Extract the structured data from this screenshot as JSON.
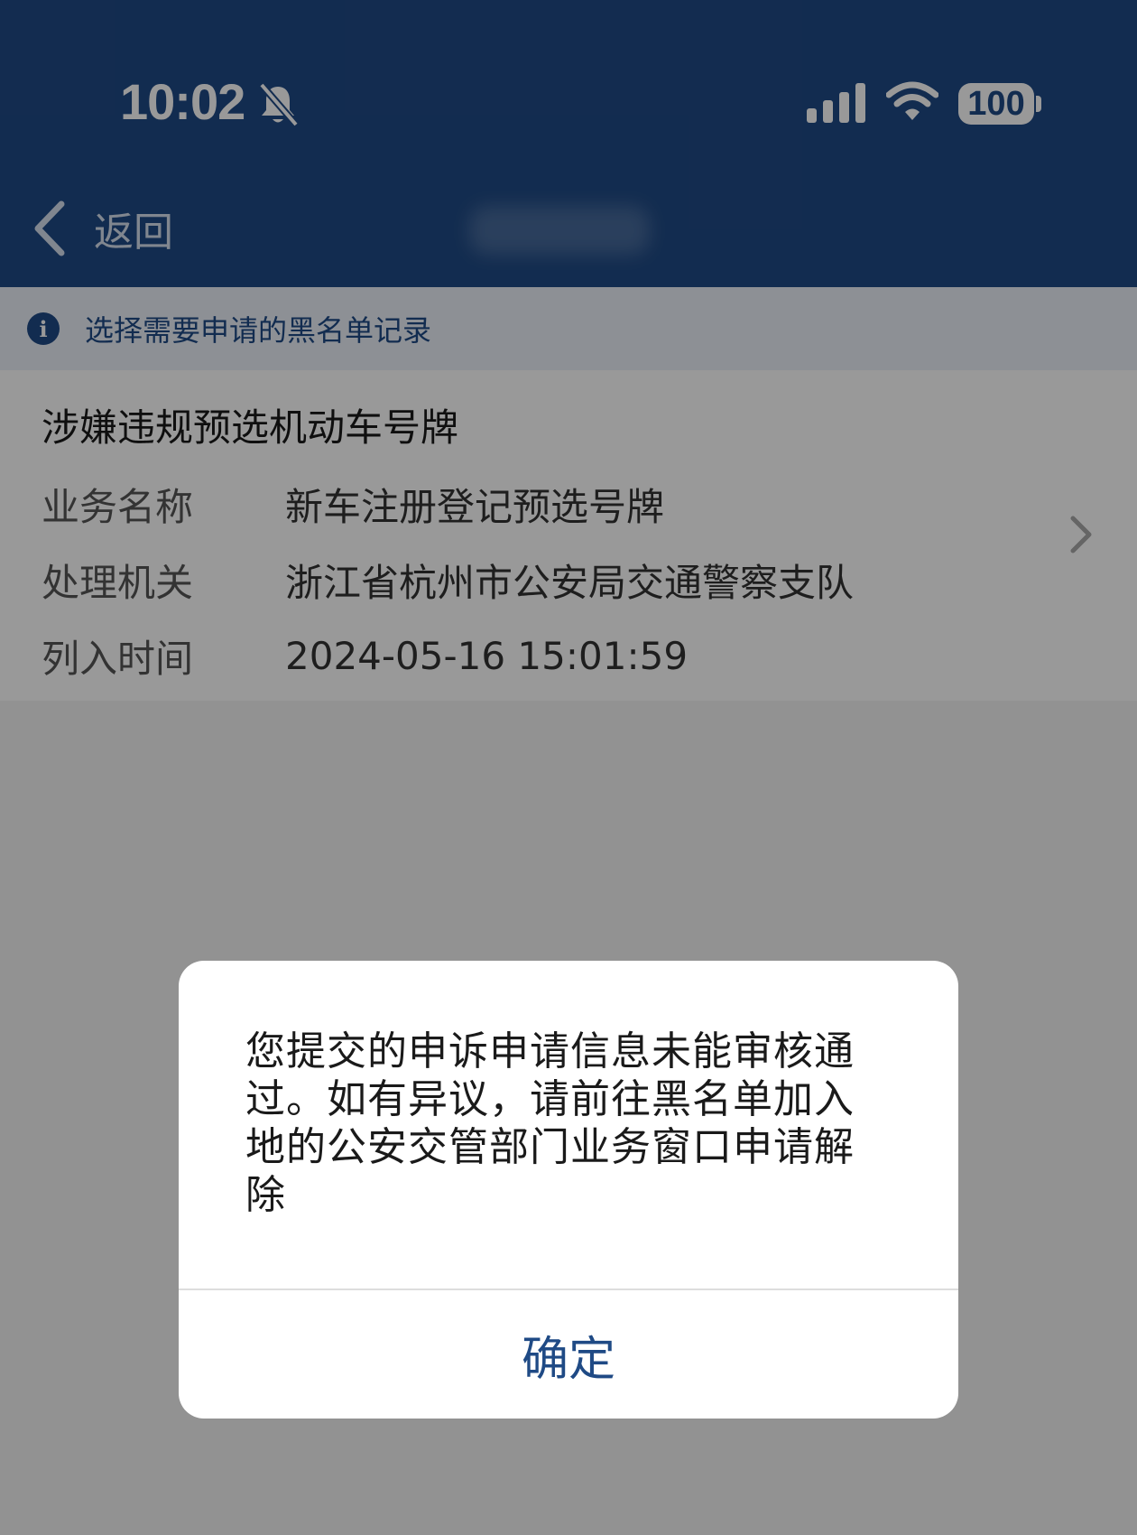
{
  "colors": {
    "header_bg": "#1f4a85",
    "accent": "#1f4a85",
    "overlay": "rgba(0,0,0,0.40)"
  },
  "status_bar": {
    "time": "10:02",
    "battery": "100",
    "icons": [
      "bell-slash-icon",
      "signal-icon",
      "wifi-icon",
      "battery-icon"
    ]
  },
  "nav": {
    "back_label": "返回",
    "back_icon": "chevron-left-icon"
  },
  "info_bar": {
    "icon": "info-icon",
    "icon_glyph": "i",
    "text": "选择需要申请的黑名单记录"
  },
  "record": {
    "title": "涉嫌违规预选机动车号牌",
    "rows": [
      {
        "label": "业务名称",
        "value": "新车注册登记预选号牌"
      },
      {
        "label": "处理机关",
        "value": "浙江省杭州市公安局交通警察支队"
      },
      {
        "label": "列入时间",
        "value": "2024-05-16 15:01:59"
      }
    ],
    "chevron_icon": "chevron-right-icon"
  },
  "dialog": {
    "message": "您提交的申诉申请信息未能审核通过。如有异议，请前往黑名单加入地的公安交管部门业务窗口申请解除",
    "confirm_label": "确定"
  }
}
